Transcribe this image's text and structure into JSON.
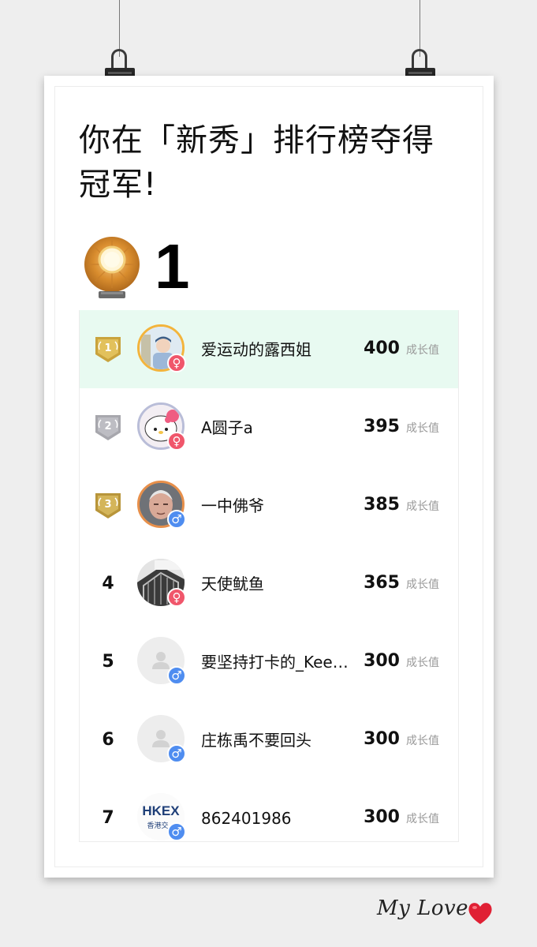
{
  "title": "你在「新秀」排行榜夺得冠军!",
  "top_rank": "1",
  "score_unit": "成长值",
  "signature": "My Love",
  "entries": [
    {
      "rank": "1",
      "name": "爱运动的露西姐",
      "score": "400",
      "gender": "♀"
    },
    {
      "rank": "2",
      "name": "A圆子a",
      "score": "395",
      "gender": "♀"
    },
    {
      "rank": "3",
      "name": "一中佛爷",
      "score": "385",
      "gender": "♂"
    },
    {
      "rank": "4",
      "name": "天使鱿鱼",
      "score": "365",
      "gender": "♀"
    },
    {
      "rank": "5",
      "name": "要坚持打卡的_Kee…",
      "score": "300",
      "gender": "♂"
    },
    {
      "rank": "6",
      "name": "庄栋禹不要回头",
      "score": "300",
      "gender": "♂"
    },
    {
      "rank": "7",
      "name": "862401986",
      "score": "300",
      "gender": "♂"
    }
  ],
  "avatar_logo_text": "HKEX",
  "avatar_logo_subtext": "香港交",
  "colors": {
    "highlight_row": "#e8faf1",
    "female": "#f0566b",
    "male": "#4f8df0",
    "gold": "#c9a33d",
    "silver": "#a7a7ad",
    "bronze": "#c2a044"
  }
}
